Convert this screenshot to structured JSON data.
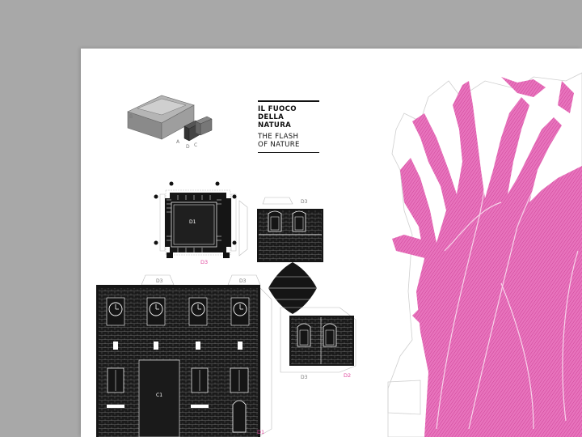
{
  "title": {
    "line1_it": "IL FUOCO",
    "line2_it": "DELLA NATURA",
    "line1_en": "THE FLASH",
    "line2_en": "OF NATURE"
  },
  "model_labels": {
    "a": "A",
    "b": "B",
    "c": "C",
    "d": "D"
  },
  "piece_labels": {
    "d1_center": "D1",
    "d3_bottom_magenta": "D3",
    "d3_top_right": "D3",
    "d3_main_left": "D3",
    "d3_main_right": "D3",
    "c1_center": "C1",
    "d1_bottom": "D1",
    "d3_lower": "D3",
    "d2_lower": "D2"
  },
  "colors": {
    "accent": "#e0489e",
    "ink": "#111111",
    "paper": "#ffffff",
    "background": "#a8a8a8"
  }
}
